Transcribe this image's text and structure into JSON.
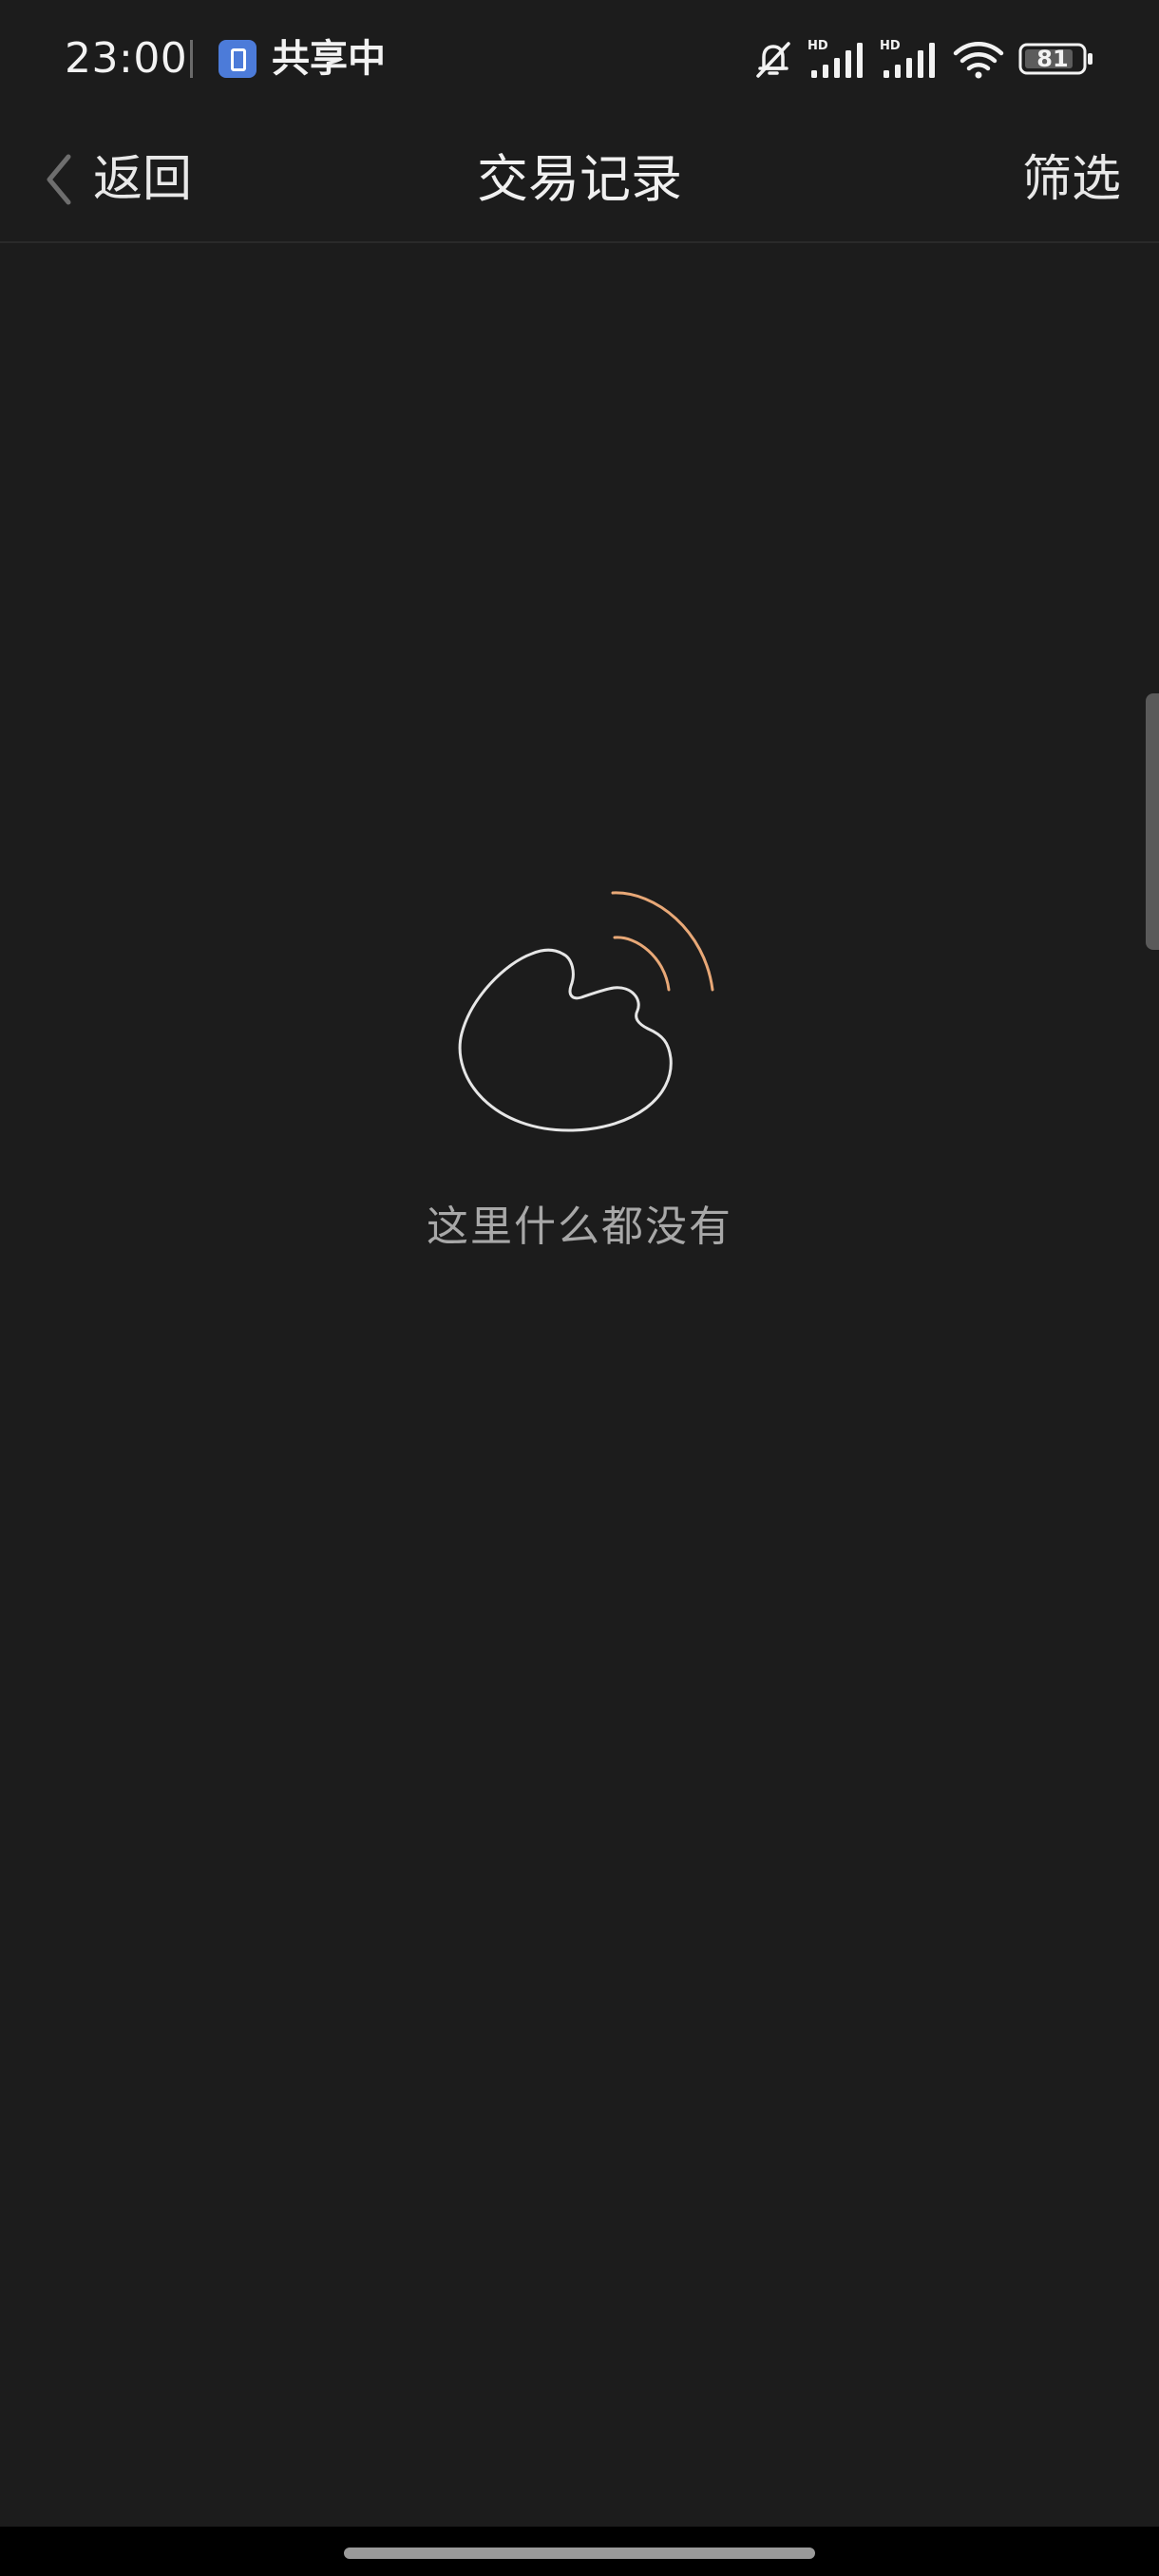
{
  "status_bar": {
    "time": "23:00",
    "share_status": "共享中",
    "share_icon": "screen-share-icon",
    "icons": [
      "bell-muted-icon",
      "signal-hd-icon",
      "signal-hd-icon",
      "wifi-icon",
      "battery-icon"
    ],
    "battery_level": "81",
    "signal_label": "HD"
  },
  "nav": {
    "back_label": "返回",
    "title": "交易记录",
    "filter_label": "筛选"
  },
  "empty_state": {
    "illustration": "empty-hand-waves-illustration",
    "message": "这里什么都没有"
  },
  "colors": {
    "background": "#1c1c1c",
    "accent_waves": "#e8a877",
    "outline": "#e6e6e6",
    "muted_text": "#a8a8a8"
  }
}
